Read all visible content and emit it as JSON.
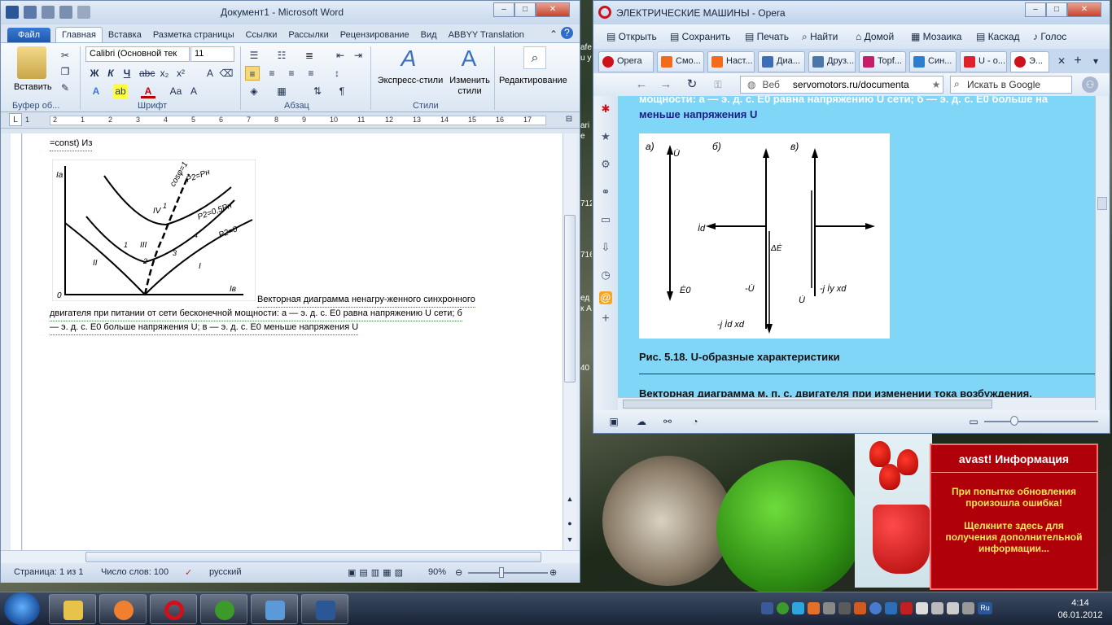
{
  "word": {
    "title": "Документ1  -  Microsoft Word",
    "tabs": [
      "Файл",
      "Главная",
      "Вставка",
      "Разметка страницы",
      "Ссылки",
      "Рассылки",
      "Рецензирование",
      "Вид",
      "ABBYY Translation"
    ],
    "ribbon": {
      "paste_label": "Вставить",
      "font_name": "Calibri (Основной тек",
      "font_size": "11",
      "express_styles": "Экспресс-стили",
      "change_styles": "Изменить стили",
      "editing": "Редактирование",
      "groups": [
        "Буфер об...",
        "Шрифт",
        "Абзац",
        "Стили"
      ]
    },
    "ruler_numbers": [
      "1",
      "2",
      "1",
      "2",
      "3",
      "4",
      "5",
      "6",
      "7",
      "8",
      "9",
      "10",
      "11",
      "12",
      "13",
      "14",
      "15",
      "16",
      "17"
    ],
    "doc": {
      "line1": "=const) Из",
      "caption_part1": "Векторная диаграмма ненагру-женного синхронного",
      "caption_part2": "двигателя при питании от сети бесконечной мощности: а — э. д. с. E0 равна напряжению U сети; б",
      "caption_part3": "— э. д. с. E0 больше напряжения U; в — э. д. с. E0 меньше напряжения U",
      "graph_labels": {
        "ia": "Iа",
        "origin": "0",
        "iv": "Iв",
        "cos": "cosφ=1",
        "p2pn": "P2=Pн",
        "p2half": "P2=0,5Pн",
        "p2zero": "P2=0",
        "r1": "I",
        "r2": "II",
        "r3": "III",
        "r4": "IV",
        "n1": "1",
        "n2": "2",
        "n3": "3",
        "n4": "4",
        "n1b": "1"
      }
    },
    "status": {
      "page": "Страница: 1 из 1",
      "words": "Число слов: 100",
      "lang": "русский",
      "zoom": "90%"
    }
  },
  "opera": {
    "title": "ЭЛЕКТРИЧЕСКИЕ МАШИНЫ - Opera",
    "menu": [
      "Открыть",
      "Сохранить",
      "Печать",
      "Найти",
      "Домой",
      "Мозаика",
      "Каскад",
      "Голос"
    ],
    "tabs": [
      "Opera",
      "Смо...",
      "Наст...",
      "Диа...",
      "Друз...",
      "Topf...",
      "Син...",
      "U - о...",
      "Э..."
    ],
    "address_label": "Веб",
    "url": "servomotors.ru/documenta",
    "search_placeholder": "Искать в Google",
    "content": {
      "top_line": "мощности: а — э. д. с. E0 равна напряжению U сети; б — э. д. с. E0 больше на",
      "top_line2": "меньше напряжения U",
      "fig_labels": {
        "a": "а)",
        "b": "б)",
        "c": "в)",
        "u": "U̇",
        "id": "İd",
        "e0": "Ė0",
        "de": "ΔĖ",
        "mu": "-U̇",
        "jidxd": "-j İd xd",
        "jiyxd": "-j İy xd",
        "u2": "U̇"
      },
      "fig_caption": "Рис. 5.18. U-образные характеристики",
      "bottom_line": "Векторная диаграмма м. п. с. двигателя при изменении тока возбуждения."
    }
  },
  "desktop_partial": [
    "afe",
    "u у",
    "ari",
    "e",
    "712",
    "716",
    "ед",
    "к А",
    "40"
  ],
  "avast": {
    "title": "avast! Информация",
    "body1": "При попытке обновления произошла ошибка!",
    "body2": "Щелкните здесь для получения дополнительной информации..."
  },
  "taskbar": {
    "time": "4:14",
    "date": "06.01.2012",
    "lang": "Ru"
  }
}
